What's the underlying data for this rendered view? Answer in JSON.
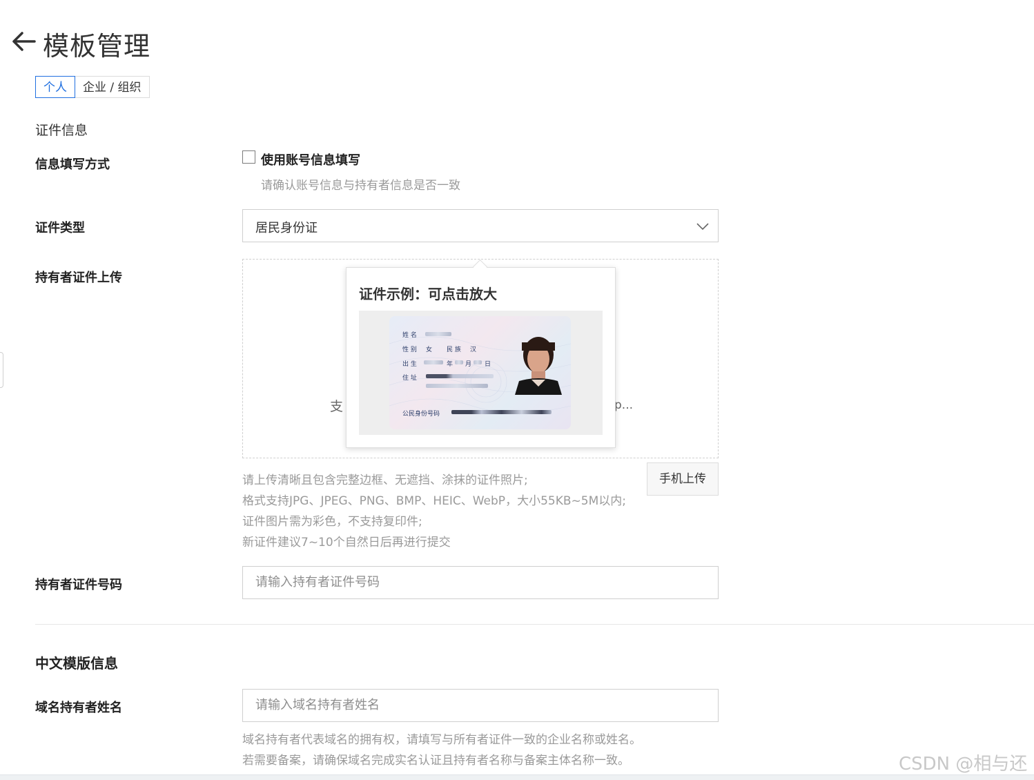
{
  "header": {
    "title": "模板管理"
  },
  "tabs": [
    {
      "label": "个人",
      "active": true
    },
    {
      "label": "企业 / 组织",
      "active": false
    }
  ],
  "section_cert": {
    "title": "证件信息"
  },
  "fill_method": {
    "label": "信息填写方式",
    "checkbox_label": "使用账号信息填写",
    "checked": false,
    "hint": "请确认账号信息与持有者信息是否一致"
  },
  "cert_type": {
    "label": "证件类型",
    "value": "居民身份证"
  },
  "upload": {
    "label": "持有者证件上传",
    "text_left": "支",
    "text_right": "p...",
    "mobile_button": "手机上传",
    "help": [
      "请上传清晰且包含完整边框、无遮挡、涂抹的证件照片;",
      "格式支持JPG、JPEG、PNG、BMP、HEIC、WebP，大小55KB~5M以内;",
      "证件图片需为彩色，不支持复印件;",
      "新证件建议7~10个自然日后再进行提交"
    ]
  },
  "popover": {
    "title": "证件示例：可点击放大",
    "card": {
      "name_label": "姓 名",
      "gender_label": "性 别",
      "gender_value": "女",
      "ethnic_label": "民 族",
      "ethnic_value": "汉",
      "birth_label": "出 生",
      "year": "年",
      "month": "月",
      "day": "日",
      "address_label": "住 址",
      "id_label": "公民身份号码"
    }
  },
  "id_number": {
    "label": "持有者证件号码",
    "placeholder": "请输入持有者证件号码"
  },
  "section_cn": {
    "title": "中文模版信息"
  },
  "holder_name": {
    "label": "域名持有者姓名",
    "placeholder": "请输入域名持有者姓名",
    "help": [
      "域名持有者代表域名的拥有权，请填写与所有者证件一致的企业名称或姓名。",
      "若需要备案，请确保域名完成实名认证且持有者名称与备案主体名称一致。"
    ]
  },
  "watermark": "CSDN @相与还",
  "colors": {
    "accent": "#1f6fe0",
    "hint": "#9a9a9a",
    "border": "#cfcfcf"
  }
}
